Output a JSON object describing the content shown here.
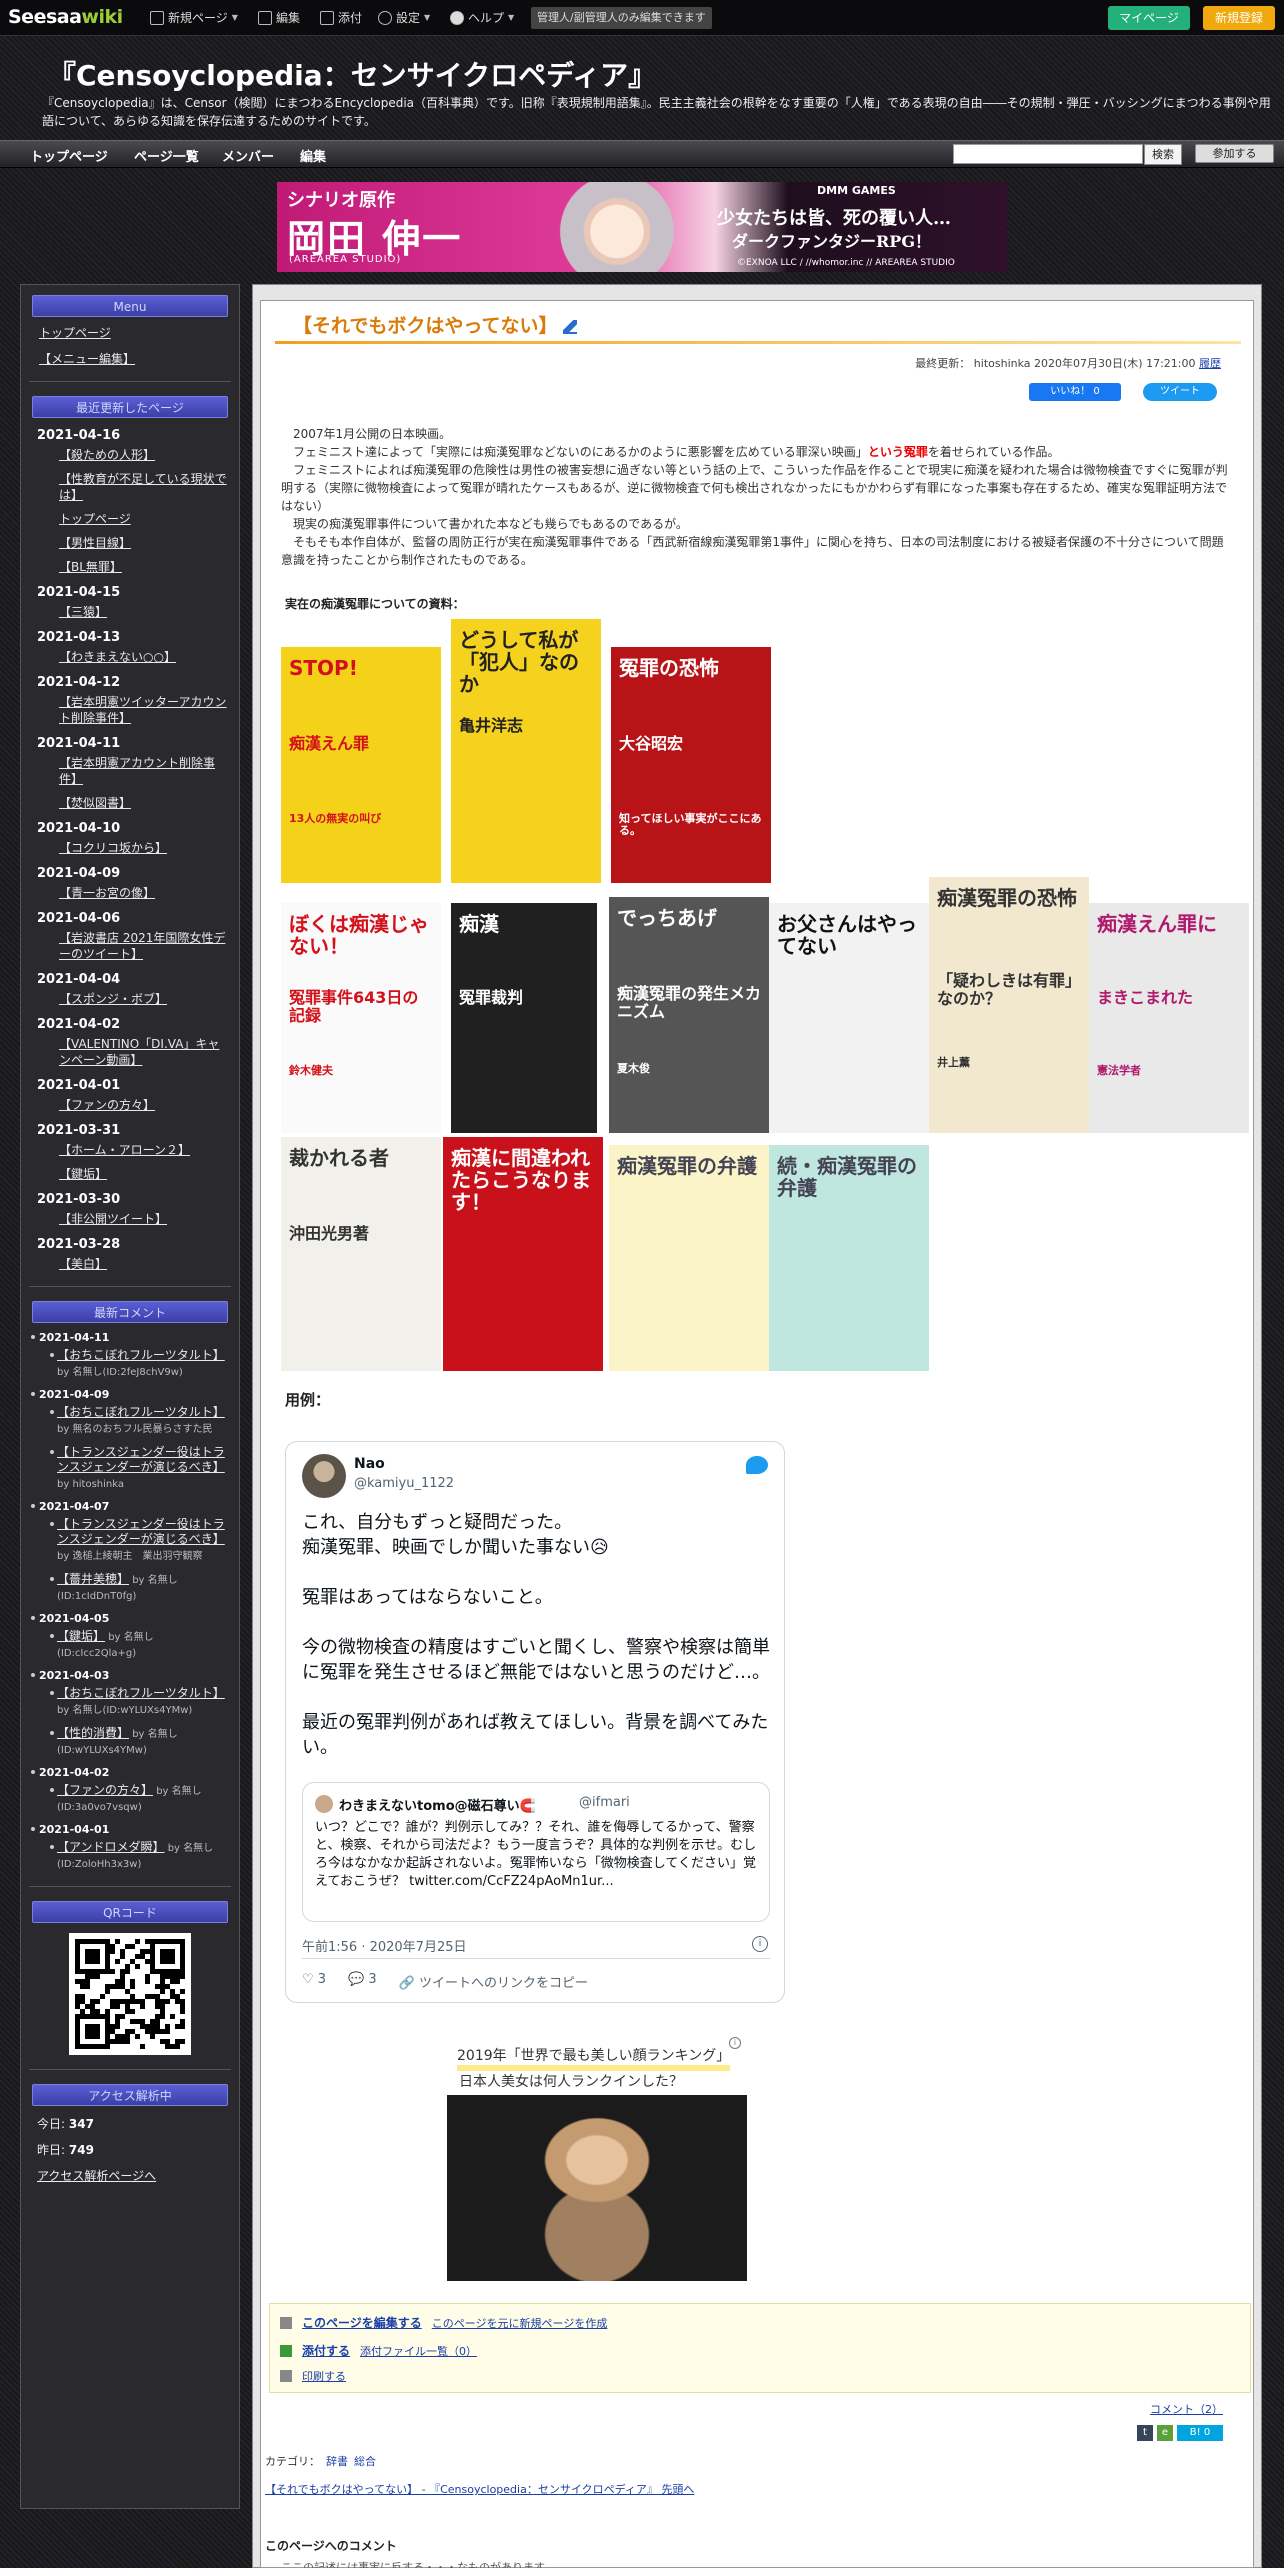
{
  "topbar": {
    "logo_main": "Seesaa",
    "logo_wiki": "wiki",
    "menu_new_page": "新規ページ",
    "menu_edit": "編集",
    "menu_attach": "添付",
    "menu_settings": "設定",
    "menu_help": "ヘルプ",
    "admin_note": "管理人/副管理人のみ編集できます",
    "mypage": "マイページ",
    "register": "新規登録"
  },
  "header": {
    "title": "『Censoyclopedia：センサイクロペディア』",
    "description": "『Censoyclopedia』は、Censor（検閲）にまつわるEncyclopedia（百科事典）です。旧称『表現規制用語集』。民主主義社会の根幹をなす重要の「人権」である表現の自由――その規制・弾圧・バッシングにまつわる事例や用語について、あらゆる知識を保存伝達するためのサイトです。"
  },
  "nav": {
    "items": [
      "トップページ",
      "ページ一覧",
      "メンバー",
      "編集"
    ],
    "search_placeholder": "",
    "search_button": "検索",
    "join_button": "参加する"
  },
  "banner": {
    "line1": "シナリオ原作",
    "line2": "岡田 伸一",
    "line3": "(AREAREA STUDIO)",
    "game_brand": "DMM GAMES",
    "game_title": "少女たちは皆、死の覆い人…",
    "game_sub": "ダークファンタジーRPG！",
    "copyright": "©EXNOA LLC / //whomor.inc // AREAREA STUDIO"
  },
  "sidebar": {
    "menu_head": "Menu",
    "menu_links": [
      "トップページ",
      "【メニュー編集】"
    ],
    "recent_head": "最近更新したページ",
    "recent": [
      {
        "date": "2021-04-16",
        "items": [
          "【殺ための人形】",
          "【性教育が不足している現状では】",
          "トップページ",
          "【男性目線】",
          "【BL無罪】"
        ]
      },
      {
        "date": "2021-04-15",
        "items": [
          "【三猿】"
        ]
      },
      {
        "date": "2021-04-13",
        "items": [
          "【わきまえない○○】"
        ]
      },
      {
        "date": "2021-04-12",
        "items": [
          "【岩本明憲ツイッターアカウント削除事件】"
        ]
      },
      {
        "date": "2021-04-11",
        "items": [
          "【岩本明憲アカウント削除事件】",
          "【焚似図書】"
        ]
      },
      {
        "date": "2021-04-10",
        "items": [
          "【コクリコ坂から】"
        ]
      },
      {
        "date": "2021-04-09",
        "items": [
          "【青一お宮の像】"
        ]
      },
      {
        "date": "2021-04-06",
        "items": [
          "【岩波書店 2021年国際女性デーのツイート】"
        ]
      },
      {
        "date": "2021-04-04",
        "items": [
          "【スポンジ・ボブ】"
        ]
      },
      {
        "date": "2021-04-02",
        "items": [
          "【VALENTINO「DI.VA」キャンペーン動画】"
        ]
      },
      {
        "date": "2021-04-01",
        "items": [
          "【ファンの方々】"
        ]
      },
      {
        "date": "2021-03-31",
        "items": [
          "【ホーム・アローン２】",
          "【鍵垢】"
        ]
      },
      {
        "date": "2021-03-30",
        "items": [
          "【非公開ツイート】"
        ]
      },
      {
        "date": "2021-03-28",
        "items": [
          "【美白】"
        ]
      }
    ],
    "comments_head": "最新コメント",
    "comments": [
      {
        "date": "2021-04-11",
        "items": [
          {
            "title": "【おちこぼれフルーツタルト】",
            "by": "by 名無し(ID:2feJ8chV9w)"
          }
        ]
      },
      {
        "date": "2021-04-09",
        "items": [
          {
            "title": "【おちこぼれフルーツタルト】",
            "by": "by 無名のおちフル民暴らさすた民"
          },
          {
            "title": "【トランスジェンダー役はトランスジェンダーが演じるべき】",
            "by": "by hitoshinka"
          }
        ]
      },
      {
        "date": "2021-04-07",
        "items": [
          {
            "title": "【トランスジェンダー役はトランスジェンダーが演じるべき】",
            "by": "by 逸槌上綾朝主　業出羽守観察"
          },
          {
            "title": "【薔井美穂】",
            "by": "by 名無し(ID:1cIdDnT0fg)"
          }
        ]
      },
      {
        "date": "2021-04-05",
        "items": [
          {
            "title": "【鍵垢】",
            "by": "by 名無し(ID:cIcc2Qla+g)"
          }
        ]
      },
      {
        "date": "2021-04-03",
        "items": [
          {
            "title": "【おちこぼれフルーツタルト】",
            "by": "by 名無し(ID:wYLUXs4YMw)"
          },
          {
            "title": "【性的消費】",
            "by": "by 名無し(ID:wYLUXs4YMw)"
          }
        ]
      },
      {
        "date": "2021-04-02",
        "items": [
          {
            "title": "【ファンの方々】",
            "by": "by 名無し(ID:3a0vo7vsqw)"
          }
        ]
      },
      {
        "date": "2021-04-01",
        "items": [
          {
            "title": "【アンドロメダ瞬】",
            "by": "by 名無し(ID:ZoloHh3x3w)"
          }
        ]
      }
    ],
    "qr_head": "QRコード",
    "access_head": "アクセス解析中",
    "access_today_label": "今日:",
    "access_today": "347",
    "access_yesterday_label": "昨日:",
    "access_yesterday": "749",
    "access_link": "アクセス解析ページへ"
  },
  "article": {
    "title": "【それでもボクはやってない】",
    "updated_label": "最終更新：",
    "updated_by": "hitoshinka",
    "updated_at": "2020年07月30日(木) 17:21:00",
    "history": "履歴",
    "fb_like": "いいね！ 0",
    "tweet": "ツイート",
    "paragraphs": [
      "2007年1月公開の日本映画。",
      "フェミニスト達によって「実際には痴漢冤罪などないのにあるかのように悪影響を広めている罪深い映画」",
      "フェミニストによれば痴漢冤罪の危険性は男性の被害妄想に過ぎない等という話の上で、こういった作品を作ることで現実に痴漢を疑われた場合は微物検査ですぐに冤罪が判明する（実際に微物検査によって冤罪が晴れたケースもあるが、逆に微物検査で何も検出されなかったにもかかわらず有罪になった事案も存在するため、確実な冤罪証明方法ではない）",
      "現実の痴漢冤罪事件について書かれた本なども幾らでもあるのであるが。",
      "そもそも本作自体が、監督の周防正行が実在痴漢冤罪事件である「西武新宿線痴漢冤罪第1事件」に関心を持ち、日本の司法制度における被疑者保護の不十分さについて問題意識を持ったことから制作されたものである。"
    ],
    "red_phrase": "という冤罪",
    "after_red": "を着せられている作品。",
    "resources_label": "実在の痴漢冤罪についての資料：",
    "books": [
      {
        "t1": "STOP!",
        "t2": "痴漢えん罪",
        "t3": "13人の無実の叫び"
      },
      {
        "t1": "どうして私が「犯人」なのか",
        "t2": "亀井洋志",
        "t3": ""
      },
      {
        "t1": "冤罪の恐怖",
        "t2": "大谷昭宏",
        "t3": "知ってほしい事実がここにある。"
      },
      {
        "t1": "ぼくは痴漢じゃない！",
        "t2": "冤罪事件643日の記録",
        "t3": "鈴木健夫"
      },
      {
        "t1": "痴漢",
        "t2": "冤罪裁判",
        "t3": ""
      },
      {
        "t1": "でっちあげ",
        "t2": "痴漢冤罪の発生メカニズム",
        "t3": "夏木俊"
      },
      {
        "t1": "お父さんはやってない",
        "t2": "",
        "t3": ""
      },
      {
        "t1": "痴漢冤罪の恐怖",
        "t2": "「疑わしきは有罪」なのか？",
        "t3": "井上薫"
      },
      {
        "t1": "痴漢えん罪に",
        "t2": "まきこまれた",
        "t3": "憲法学者"
      },
      {
        "t1": "裁かれる者",
        "t2": "沖田光男著",
        "t3": ""
      },
      {
        "t1": "痴漢に間違われたらこうなります！",
        "t2": "",
        "t3": ""
      },
      {
        "t1": "痴漢冤罪の弁護",
        "t2": "",
        "t3": ""
      },
      {
        "t1": "続・痴漢冤罪の弁護",
        "t2": "",
        "t3": ""
      }
    ],
    "examples_label": "用例：",
    "tweet_embed": {
      "name": "Nao",
      "handle": "@kamiyu_1122",
      "lines": [
        "これ、自分もずっと疑問だった。",
        "痴漢冤罪、映画でしか聞いた事ない😥",
        "",
        "冤罪はあってはならないこと。",
        "",
        "今の微物検査の精度はすごいと聞くし、警察や検察は簡単に冤罪を発生させるほど無能ではないと思うのだけど…。",
        "",
        "最近の冤罪判例があれば教えてほしい。背景を調べてみたい。"
      ],
      "quote_name": "わきまえないtomo@磁石尊い🧲",
      "quote_handle": "@ifmari",
      "quote_body": "いつ？どこで？誰が？判例示してみ？？それ、誰を侮辱してるかって、警察と、検察、それから司法だよ？もう一度言うぞ？具体的な判例を示せ。むしろ今はなかなか起訴されないよ。冤罪怖いなら「微物検査してください」覚えておこうぜ？ twitter.com/CcFZ24pAoMn1ur...",
      "meta": "午前1:56 · 2020年7月25日",
      "likes": "3",
      "replies": "3",
      "copy_link": "ツイートへのリンクをコピー"
    },
    "ad_rank": "2019年「世界で最も美しい顔ランキング」",
    "ad_question": "日本人美女は何人ランクインした？",
    "edit_page": "このページを編集する",
    "new_from_page": "このページを元に新規ページを作成",
    "attach": "添付する",
    "attach_list": "添付ファイル一覧（0）",
    "print": "印刷する",
    "comment_link": "コメント（2）",
    "category_label": "カテゴリ：",
    "categories": [
      "辞書",
      "総合"
    ],
    "permalink": "【それでもボクはやってない】 - 『Censoyclopedia：センサイクロペディア』 先頭へ",
    "comment_head": "このページへのコメント",
    "comment_note": "ここの記述には事実に反する・・・なものがあります。"
  }
}
